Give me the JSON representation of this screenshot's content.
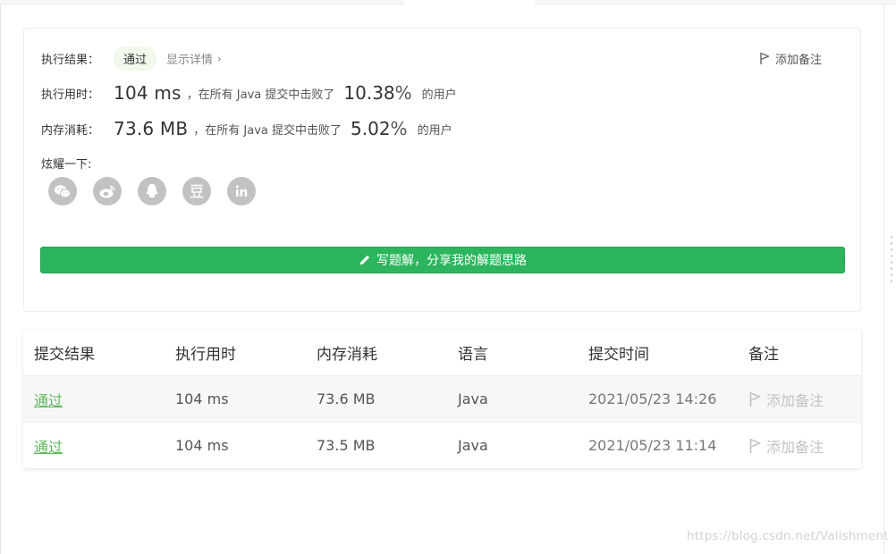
{
  "result": {
    "status_label": "执行结果：",
    "status_value": "通过",
    "detail_link": "显示详情",
    "add_note": "添加备注",
    "runtime": {
      "label": "执行用时：",
      "value": "104 ms",
      "middle": "，在所有 Java 提交中击败了",
      "percent": "10.38",
      "percent_sign": "%",
      "suffix": "的用户"
    },
    "memory": {
      "label": "内存消耗：",
      "value": "73.6 MB",
      "middle": "，在所有 Java 提交中击败了",
      "percent": "5.02",
      "percent_sign": "%",
      "suffix": "的用户"
    },
    "share_label": "炫耀一下:",
    "share_icons": [
      "wechat-icon",
      "weibo-icon",
      "qq-icon",
      "douban-icon",
      "linkedin-icon"
    ],
    "solution_button": "写题解，分享我的解题思路"
  },
  "submissions": {
    "headers": [
      "提交结果",
      "执行用时",
      "内存消耗",
      "语言",
      "提交时间",
      "备注"
    ],
    "rows": [
      {
        "status": "通过",
        "runtime": "104 ms",
        "memory": "73.6 MB",
        "language": "Java",
        "time": "2021/05/23 14:26",
        "note": "添加备注"
      },
      {
        "status": "通过",
        "runtime": "104 ms",
        "memory": "73.5 MB",
        "language": "Java",
        "time": "2021/05/23 11:14",
        "note": "添加备注"
      }
    ]
  },
  "watermark": "https://blog.csdn.net/Valishment",
  "colors": {
    "accent_green": "#2db55d",
    "pass_green": "#5cb85c",
    "pill_bg": "#f1f8ec",
    "icon_gray": "#c2c2c2"
  }
}
